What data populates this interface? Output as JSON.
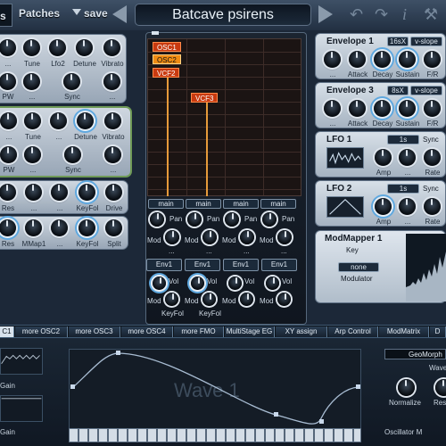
{
  "toolbar": {
    "partial_tab": "sis",
    "patches_label": "Patches",
    "save_label": "save",
    "patch_name": "Batcave psirens"
  },
  "osc_row1": {
    "labels": [
      "...",
      "Tune",
      "Lfo2",
      "Detune",
      "Vibrato"
    ],
    "row2": [
      "PW",
      "...",
      "Sync",
      "..."
    ]
  },
  "osc_row2": {
    "labels": [
      "...",
      "Tune",
      "...",
      "Detune",
      "Vibrato"
    ],
    "row2": [
      "PW",
      "...",
      "Sync",
      "..."
    ]
  },
  "filter_row1": {
    "labels": [
      "Res",
      "...",
      "...",
      "KeyFol",
      "Drive"
    ]
  },
  "filter_row2": {
    "labels": [
      "Res",
      "MMap1",
      "...",
      "KeyFol",
      "Split"
    ]
  },
  "matrix": {
    "nodes": [
      "OSC1",
      "OSC2",
      "VCF2",
      "VCF3"
    ],
    "out_buttons": [
      "main",
      "main",
      "main",
      "main"
    ],
    "pan_labels": [
      "Pan",
      "Pan",
      "Pan",
      "Pan"
    ],
    "mod_labels": [
      "Mod",
      "Mod",
      "Mod",
      "Mod"
    ],
    "dots": [
      "...",
      "...",
      "...",
      "..."
    ],
    "env_buttons": [
      "Env1",
      "Env1",
      "Env1",
      "Env1"
    ],
    "vol_labels": [
      "Vol",
      "Vol",
      "Vol",
      "Vol"
    ],
    "mod2_labels": [
      "Mod",
      "Mod",
      "Mod",
      "Mod"
    ],
    "keyfol_labels": [
      "KeyFol",
      "KeyFol"
    ]
  },
  "env1": {
    "title": "Envelope 1",
    "time": "16sX",
    "mode": "v-slope",
    "labels": [
      "...",
      "Attack",
      "Decay",
      "Sustain",
      "F/R"
    ]
  },
  "env3": {
    "title": "Envelope 3",
    "time": "8sX",
    "mode": "v-slope",
    "labels": [
      "...",
      "Attack",
      "Decay",
      "Sustain",
      "F/R"
    ]
  },
  "lfo1": {
    "title": "LFO 1",
    "rate_box": "1s",
    "sync": "Sync",
    "labels": [
      "Amp",
      "...",
      "Rate"
    ]
  },
  "lfo2": {
    "title": "LFO 2",
    "rate_box": "1s",
    "sync": "Sync",
    "labels": [
      "Amp",
      "...",
      "Rate"
    ]
  },
  "modmapper": {
    "title": "ModMapper 1",
    "key_label": "Key",
    "modulator_value": "none",
    "modulator_label": "Modulator"
  },
  "tabs": [
    "C1",
    "more OSC2",
    "more OSC3",
    "more OSC4",
    "more FMO",
    "MultiStage EG",
    "XY assign",
    "Arp Control",
    "ModMatrix",
    "D"
  ],
  "bottom": {
    "gain1": "Gain",
    "gain2": "Gain",
    "wave_label": "Wave 1",
    "geomorph": "GeoMorph",
    "wave_right": "Wave",
    "normalize": "Normalize",
    "reset": "Rese",
    "osc_mode": "Oscillator M"
  },
  "colors": {
    "accent": "#5fa8df",
    "node_active": "#f08c14",
    "node": "#c83a10",
    "green_border": "#6f9a57"
  }
}
